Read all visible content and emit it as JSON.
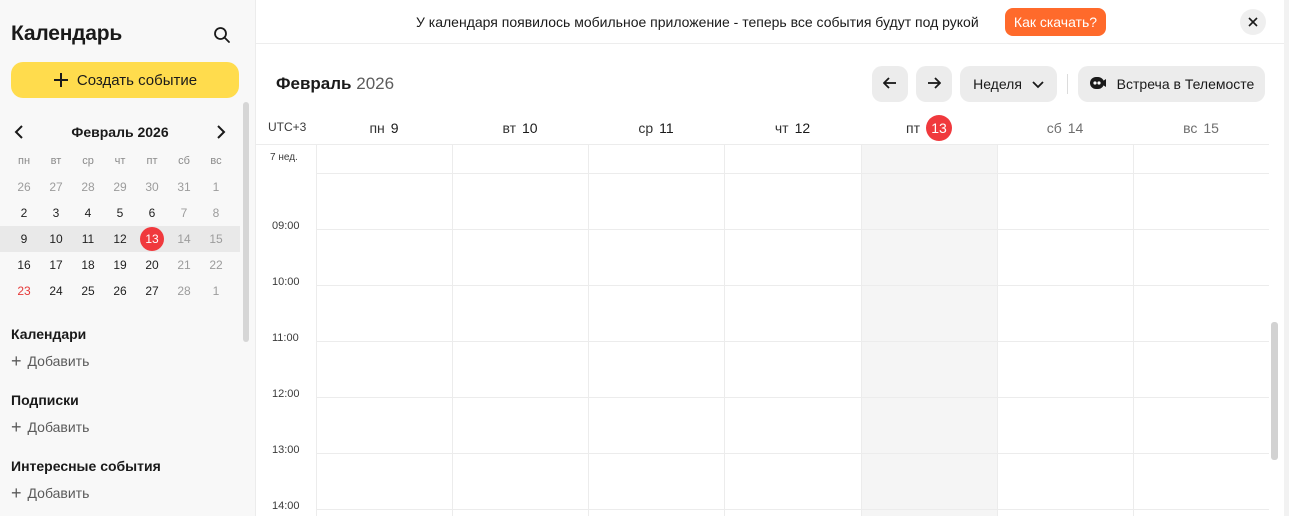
{
  "sidebar": {
    "title": "Календарь",
    "create_label": "Создать событие",
    "mini_calendar": {
      "title": "Февраль 2026",
      "weekdays": [
        "пн",
        "вт",
        "ср",
        "чт",
        "пт",
        "сб",
        "вс"
      ],
      "weeks": [
        [
          "26",
          "27",
          "28",
          "29",
          "30",
          "31",
          "1"
        ],
        [
          "2",
          "3",
          "4",
          "5",
          "6",
          "7",
          "8"
        ],
        [
          "9",
          "10",
          "11",
          "12",
          "13",
          "14",
          "15"
        ],
        [
          "16",
          "17",
          "18",
          "19",
          "20",
          "21",
          "22"
        ],
        [
          "23",
          "24",
          "25",
          "26",
          "27",
          "28",
          "1"
        ]
      ],
      "today": "13"
    },
    "sections": [
      {
        "title": "Календари",
        "add_label": "Добавить"
      },
      {
        "title": "Подписки",
        "add_label": "Добавить"
      },
      {
        "title": "Интересные события",
        "add_label": "Добавить"
      }
    ]
  },
  "banner": {
    "text": "У календаря появилось мобильное приложение - теперь все события будут под рукой",
    "button_label": "Как скачать?",
    "button_color": "#ff6a2b"
  },
  "header": {
    "month": "Февраль",
    "year": "2026",
    "view_label": "Неделя",
    "telemost_label": "Встреча в Телемосте"
  },
  "week": {
    "timezone": "UTC+3",
    "week_number": "7 нед.",
    "days": [
      {
        "dow": "пн",
        "num": "9"
      },
      {
        "dow": "вт",
        "num": "10"
      },
      {
        "dow": "ср",
        "num": "11"
      },
      {
        "dow": "чт",
        "num": "12"
      },
      {
        "dow": "пт",
        "num": "13"
      },
      {
        "dow": "сб",
        "num": "14"
      },
      {
        "dow": "вс",
        "num": "15"
      }
    ],
    "times": [
      "09:00",
      "10:00",
      "11:00",
      "12:00",
      "13:00",
      "14:00"
    ]
  },
  "colors": {
    "accent_yellow": "#ffdc4d",
    "today_red": "#f0393d"
  }
}
